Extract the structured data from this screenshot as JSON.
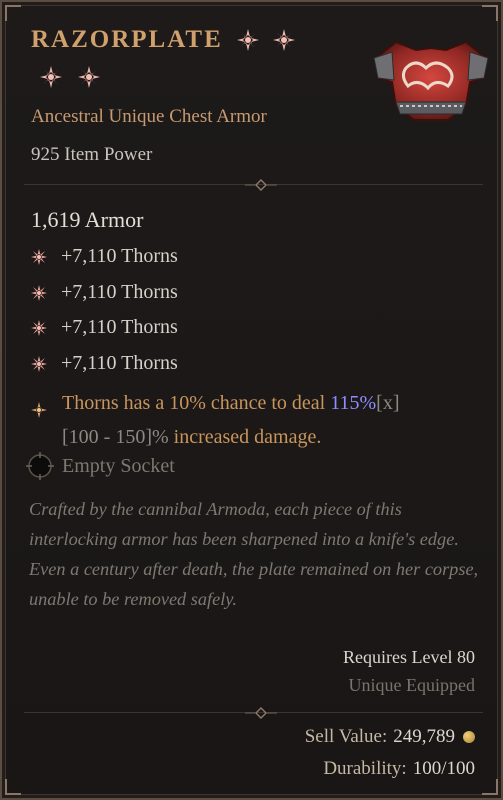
{
  "item": {
    "name": "RAZORPLATE",
    "subtitle": "Ancestral Unique Chest Armor",
    "power": "925 Item Power",
    "armor": "1,619 Armor",
    "affixes": [
      "+7,110 Thorns",
      "+7,110 Thorns",
      "+7,110 Thorns",
      "+7,110 Thorns"
    ],
    "unique_power": {
      "pre": "Thorns has a 10% chance to deal ",
      "value": "115%",
      "value_marker": "[x]",
      "range": "[100 - 150]%",
      "post": " increased damage."
    },
    "socket": "Empty Socket",
    "flavor": "Crafted by the cannibal Armoda, each piece of this interlocking armor has been sharpened into a knife's edge. Even a century after death, the plate remained on her corpse, unable to be removed safely.",
    "requires_level": "Requires Level 80",
    "unique_equipped": "Unique Equipped",
    "sell_label": "Sell Value:",
    "sell_value": "249,789",
    "durability_label": "Durability:",
    "durability_value": "100/100"
  },
  "colors": {
    "unique": "#c8955c",
    "title": "#d0a16c",
    "highlight": "#8f8dff",
    "affix_star": "#e8a199"
  },
  "icons": {
    "greater_affix": "star-burst-icon",
    "affix_bullet": "affix-star-icon",
    "unique_bullet": "unique-star-icon",
    "socket": "empty-socket-icon",
    "gold": "gold-coin-icon"
  }
}
